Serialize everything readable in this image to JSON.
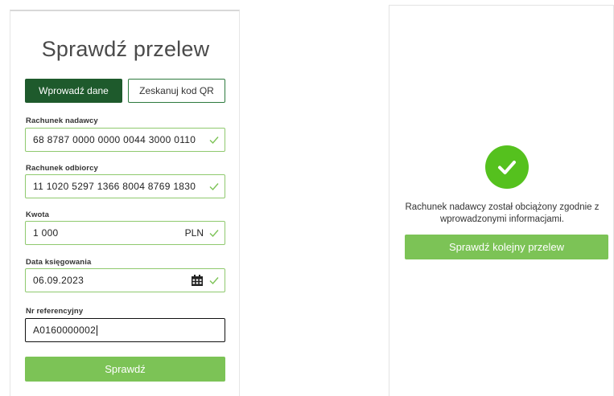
{
  "left": {
    "title": "Sprawdź przelew",
    "tabs": {
      "manual": "Wprowadź dane",
      "qr": "Zeskanuj kod QR"
    },
    "fields": {
      "sender": {
        "label": "Rachunek nadawcy",
        "value": "68 8787 0000 0000 0044 3000 0110"
      },
      "recipient": {
        "label": "Rachunek odbiorcy",
        "value": "11 1020 5297 1366 8004 8769 1830"
      },
      "amount": {
        "label": "Kwota",
        "value": "1 000",
        "currency": "PLN"
      },
      "date": {
        "label": "Data księgowania",
        "value": "06.09.2023"
      },
      "reference": {
        "label": "Nr referencyjny",
        "value": "A0160000002"
      }
    },
    "submit_label": "Sprawdź"
  },
  "right": {
    "message": "Rachunek nadawcy został obciążony zgodnie z wprowadzonymi informacjami.",
    "next_label": "Sprawdź kolejny przelew"
  },
  "colors": {
    "dark_green": "#1e5a2c",
    "button_green": "#7cc356",
    "success_green": "#55c11e",
    "valid_border": "#8fc96e"
  },
  "icons": {
    "valid": "check-icon",
    "calendar": "calendar-icon",
    "success": "checkmark-circle-icon"
  }
}
